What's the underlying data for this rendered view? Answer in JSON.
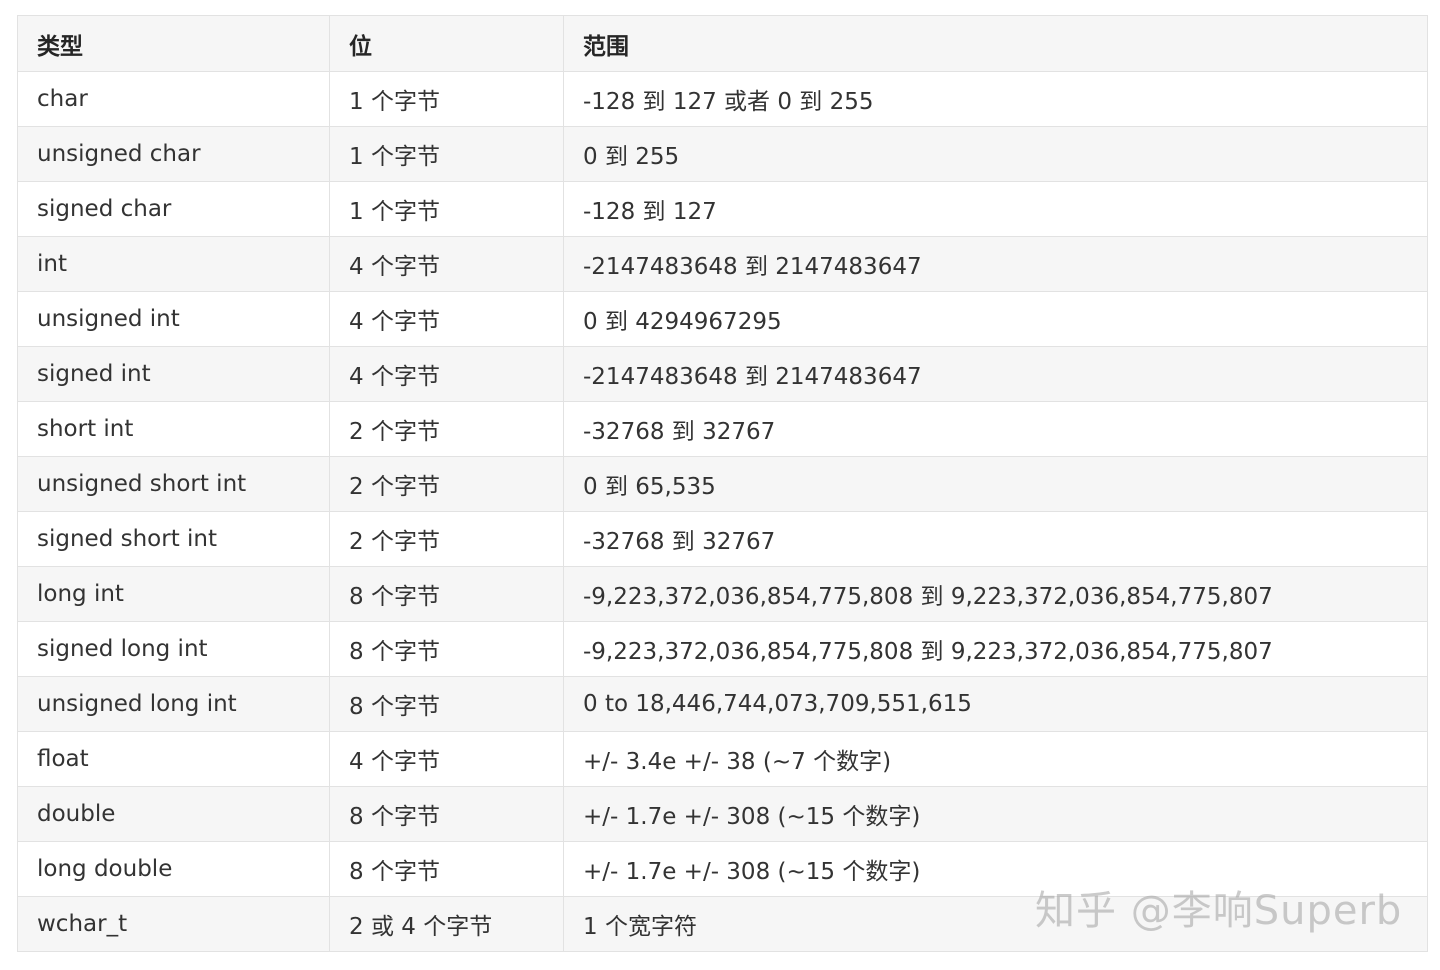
{
  "table": {
    "headers": [
      "类型",
      "位",
      "范围"
    ],
    "rows": [
      [
        "char",
        "1 个字节",
        "-128 到 127 或者 0 到 255"
      ],
      [
        "unsigned char",
        "1 个字节",
        "0 到 255"
      ],
      [
        "signed char",
        "1 个字节",
        "-128 到 127"
      ],
      [
        "int",
        "4 个字节",
        "-2147483648 到 2147483647"
      ],
      [
        "unsigned int",
        "4 个字节",
        "0 到 4294967295"
      ],
      [
        "signed int",
        "4 个字节",
        "-2147483648 到 2147483647"
      ],
      [
        "short int",
        "2 个字节",
        "-32768 到 32767"
      ],
      [
        "unsigned short int",
        "2 个字节",
        "0 到 65,535"
      ],
      [
        "signed short int",
        "2 个字节",
        "-32768 到 32767"
      ],
      [
        "long int",
        "8 个字节",
        "-9,223,372,036,854,775,808 到 9,223,372,036,854,775,807"
      ],
      [
        "signed long int",
        "8 个字节",
        "-9,223,372,036,854,775,808 到 9,223,372,036,854,775,807"
      ],
      [
        "unsigned long int",
        "8 个字节",
        "0 to 18,446,744,073,709,551,615"
      ],
      [
        "float",
        "4 个字节",
        "+/- 3.4e +/- 38 (~7 个数字)"
      ],
      [
        "double",
        "8 个字节",
        "+/- 1.7e +/- 308 (~15 个数字)"
      ],
      [
        "long double",
        "8 个字节",
        "+/- 1.7e +/- 308 (~15 个数字)"
      ],
      [
        "wchar_t",
        "2 或 4 个字节",
        "1 个宽字符"
      ]
    ]
  },
  "watermark": "知乎 @李响Superb"
}
